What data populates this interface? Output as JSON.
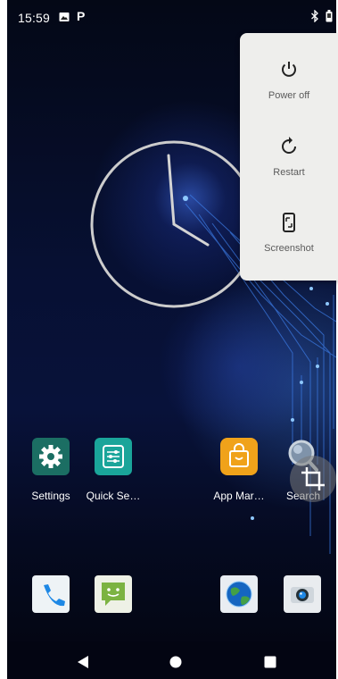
{
  "status_bar": {
    "time": "15:59",
    "icons": [
      "image-notification-icon",
      "p-notification-icon",
      "bluetooth-icon",
      "battery-icon"
    ],
    "p_glyph": "P"
  },
  "clock": {
    "hour_hand_angle_deg": 125,
    "minute_hand_angle_deg": -4
  },
  "power_menu": {
    "items": [
      {
        "label": "Power off",
        "icon": "power-icon"
      },
      {
        "label": "Restart",
        "icon": "restart-icon"
      },
      {
        "label": "Screenshot",
        "icon": "screenshot-icon"
      }
    ]
  },
  "apps": [
    {
      "label": "Settings",
      "icon": "settings-gear-icon",
      "color": "#1b6e63"
    },
    {
      "label": "Quick Se…",
      "icon": "sliders-icon",
      "color": "#1aa59a"
    },
    {
      "label": "App Mar…",
      "icon": "shopping-bag-icon",
      "color": "#f0a21a"
    },
    {
      "label": "Search",
      "icon": "magnifier-icon",
      "color": "#9aa7b5"
    }
  ],
  "dock": [
    {
      "name": "phone",
      "icon": "phone-icon",
      "color": "#1e88e5"
    },
    {
      "name": "messages",
      "icon": "message-icon",
      "color": "#8bc34a"
    },
    {
      "name": "browser",
      "icon": "globe-icon",
      "color": "#1f76c8"
    },
    {
      "name": "camera",
      "icon": "camera-icon",
      "color": "#1565c0"
    }
  ],
  "floating_button": {
    "icon": "crop-icon"
  },
  "nav_bar": {
    "buttons": [
      "back-icon",
      "home-icon",
      "recents-icon"
    ]
  }
}
